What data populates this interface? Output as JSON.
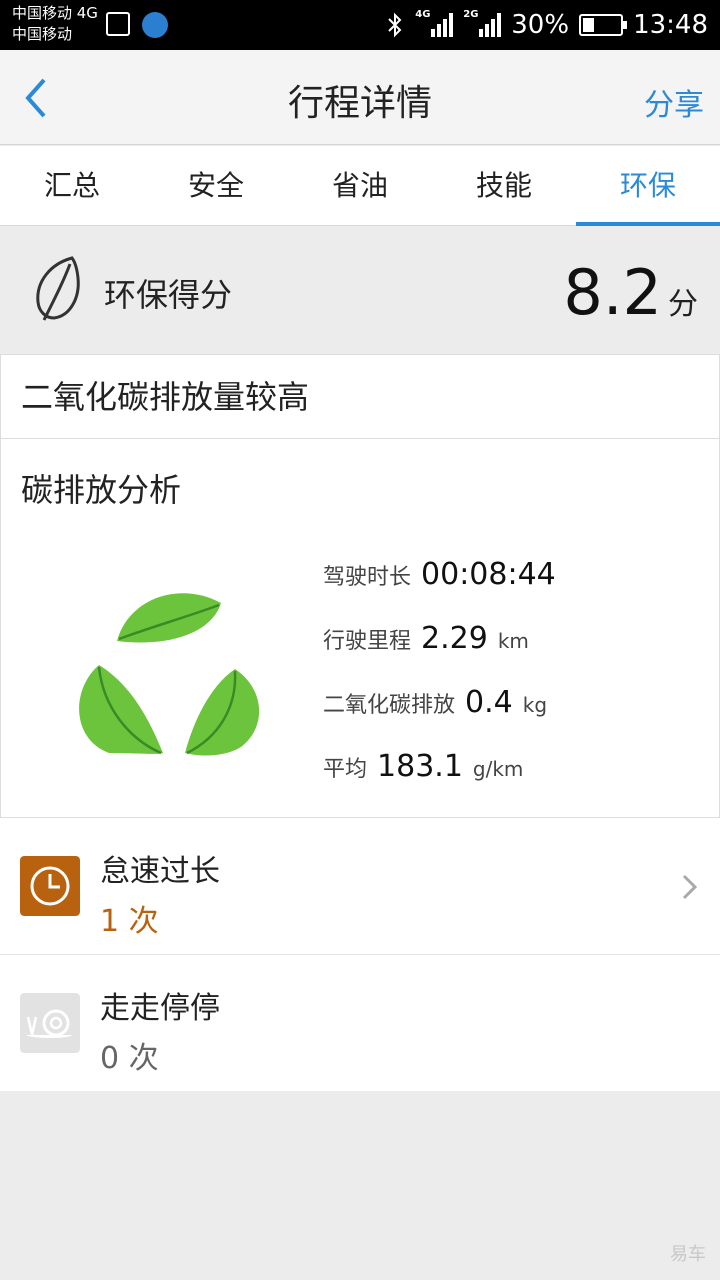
{
  "status_bar": {
    "carrier_line1": "中国移动 4G",
    "carrier_line2": "中国移动",
    "net1": "4G",
    "net2": "2G",
    "battery_percent": "30%",
    "time": "13:48"
  },
  "header": {
    "title": "行程详情",
    "share_label": "分享"
  },
  "tabs": [
    {
      "label": "汇总"
    },
    {
      "label": "安全"
    },
    {
      "label": "省油"
    },
    {
      "label": "技能"
    },
    {
      "label": "环保",
      "active": true
    }
  ],
  "score": {
    "label": "环保得分",
    "value": "8.2",
    "unit": "分"
  },
  "card": {
    "headline": "二氧化碳排放量较高",
    "section_title": "碳排放分析",
    "stats": [
      {
        "key": "驾驶时长",
        "value": "00:08:44",
        "unit": ""
      },
      {
        "key": "行驶里程",
        "value": "2.29",
        "unit": "km"
      },
      {
        "key": "二氧化碳排放",
        "value": "0.4",
        "unit": "kg"
      },
      {
        "key": "平均",
        "value": "183.1",
        "unit": "g/km"
      }
    ]
  },
  "list": [
    {
      "title": "怠速过长",
      "count": "1 次",
      "icon": "clock-icon",
      "icon_color": "#b8620f",
      "count_color": "#b8620f",
      "has_chevron": true
    },
    {
      "title": "走走停停",
      "count": "0 次",
      "icon": "snail-icon",
      "icon_color": "#e2e2e2",
      "count_color": "#666666",
      "has_chevron": false
    }
  ],
  "colors": {
    "accent": "#2a8ad8",
    "leaf_green": "#6cc43c"
  }
}
